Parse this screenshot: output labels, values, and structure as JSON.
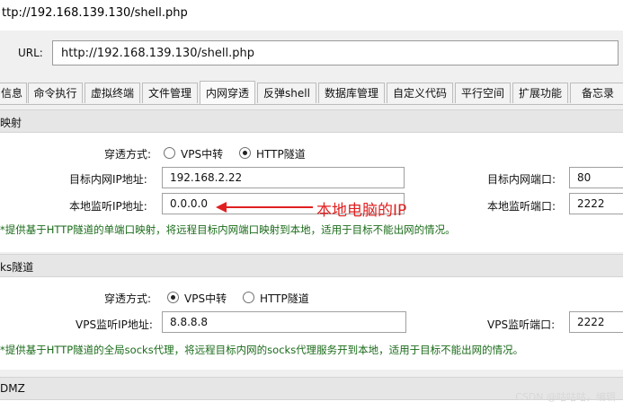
{
  "window": {
    "title": "ttp://192.168.139.130/shell.php"
  },
  "url_bar": {
    "label": "URL:",
    "value": "http://192.168.139.130/shell.php"
  },
  "tabs": [
    {
      "label": "信息"
    },
    {
      "label": "命令执行"
    },
    {
      "label": "虚拟终端"
    },
    {
      "label": "文件管理"
    },
    {
      "label": "内网穿透",
      "active": true
    },
    {
      "label": "反弹shell"
    },
    {
      "label": "数据库管理"
    },
    {
      "label": "自定义代码"
    },
    {
      "label": "平行空间"
    },
    {
      "label": "扩展功能"
    },
    {
      "label": "备忘录"
    }
  ],
  "port_mapping": {
    "title": "映射",
    "mode_label": "穿透方式:",
    "mode_options": [
      "VPS中转",
      "HTTP隧道"
    ],
    "selected_mode": "HTTP隧道",
    "target_ip_label": "目标内网IP地址:",
    "target_ip": "192.168.2.22",
    "target_port_label": "目标内网端口:",
    "target_port": "80",
    "local_ip_label": "本地监听IP地址:",
    "local_ip": "0.0.0.0",
    "local_port_label": "本地监听端口:",
    "local_port": "2222",
    "hint": "*提供基于HTTP隧道的单端口映射，将远程目标内网端口映射到本地，适用于目标不能出网的情况。"
  },
  "annotation": {
    "text": "本地电脑的IP",
    "color": "#e02020"
  },
  "socks": {
    "title": "ks隧道",
    "mode_label": "穿透方式:",
    "mode_options": [
      "VPS中转",
      "HTTP隧道"
    ],
    "selected_mode": "VPS中转",
    "vps_ip_label": "VPS监听IP地址:",
    "vps_ip": "8.8.8.8",
    "vps_port_label": "VPS监听端口:",
    "vps_port": "2222",
    "hint": "*提供基于HTTP隧道的全局socks代理，将远程目标内网的socks代理服务开到本地，适用于目标不能出网的情况。"
  },
  "dmz": {
    "title": "DMZ"
  },
  "watermark": "CSDN @咕咕咕，编辑"
}
